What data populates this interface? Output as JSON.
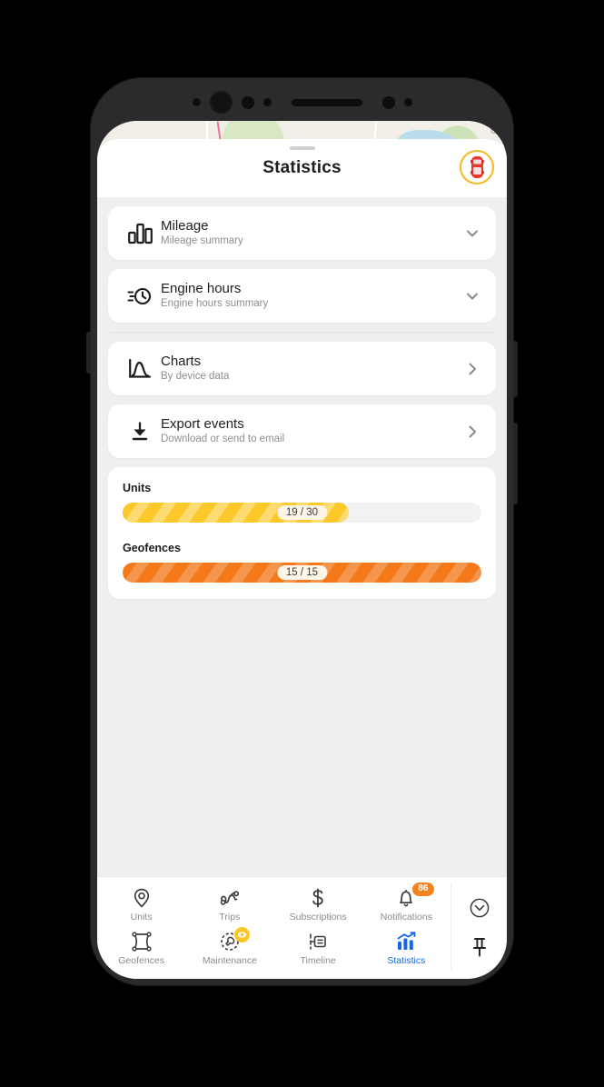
{
  "header": {
    "title": "Statistics",
    "avatar_icon": "red-car-avatar-icon",
    "avatar_ring_color": "#f5b820"
  },
  "map": {
    "attribution": "Go"
  },
  "list": [
    {
      "icon": "bar-chart-icon",
      "title": "Mileage",
      "subtitle": "Mileage summary",
      "chevron": "chevron-down-icon"
    },
    {
      "icon": "engine-hours-clock-icon",
      "title": "Engine hours",
      "subtitle": "Engine hours summary",
      "chevron": "chevron-down-icon"
    },
    {
      "icon": "chart-curve-icon",
      "title": "Charts",
      "subtitle": "By device data",
      "chevron": "chevron-right-icon"
    },
    {
      "icon": "download-icon",
      "title": "Export events",
      "subtitle": "Download or send to email",
      "chevron": "chevron-right-icon"
    }
  ],
  "quotas": [
    {
      "label": "Units",
      "value_text": "19 / 30",
      "used": 19,
      "total": 30,
      "percent": 63,
      "color": "#fdc82a",
      "track_color": "#f2f2f2"
    },
    {
      "label": "Geofences",
      "value_text": "15 / 15",
      "used": 15,
      "total": 15,
      "percent": 100,
      "color": "#f4791a",
      "track_color": "#f2f2f2"
    }
  ],
  "bottom_nav": {
    "row1": [
      {
        "label": "Units",
        "icon": "map-pin-icon",
        "active": false,
        "badge": null
      },
      {
        "label": "Trips",
        "icon": "route-icon",
        "active": false,
        "badge": null
      },
      {
        "label": "Subscriptions",
        "icon": "dollar-sign-icon",
        "active": false,
        "badge": null
      },
      {
        "label": "Notifications",
        "icon": "bell-icon",
        "active": false,
        "badge": "86"
      }
    ],
    "row2": [
      {
        "label": "Geofences",
        "icon": "geofence-square-icon",
        "active": false,
        "badge": null
      },
      {
        "label": "Maintenance",
        "icon": "wrench-dashed-circle-icon",
        "active": false,
        "badge": "dot"
      },
      {
        "label": "Timeline",
        "icon": "timeline-icon",
        "active": false,
        "badge": null
      },
      {
        "label": "Statistics",
        "icon": "statistics-trend-icon",
        "active": true,
        "badge": null
      }
    ],
    "side_buttons": [
      {
        "icon": "circle-chevron-down-icon",
        "name": "collapse-sheet-button"
      },
      {
        "icon": "pin-icon",
        "name": "pin-panel-button"
      }
    ],
    "active_color": "#1567e8",
    "badge_color": "#f4831f"
  }
}
